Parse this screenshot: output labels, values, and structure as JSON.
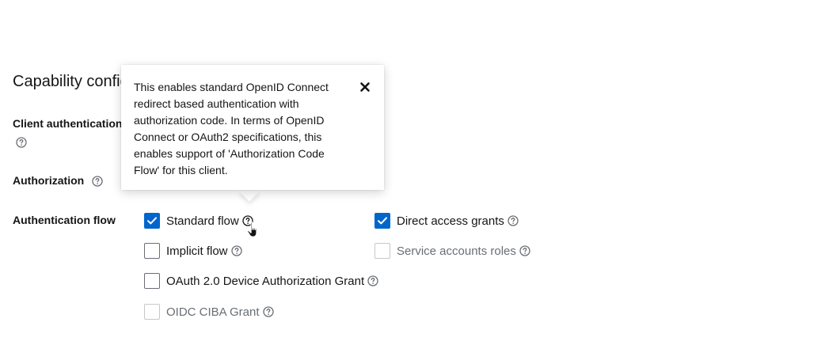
{
  "section": {
    "title": "Capability config"
  },
  "fields": {
    "client_authentication_label": "Client authentication",
    "authorization_label": "Authorization",
    "authentication_flow_label": "Authentication flow"
  },
  "flows": {
    "standard_flow": {
      "label": "Standard flow",
      "checked": true,
      "disabled": false
    },
    "implicit_flow": {
      "label": "Implicit flow",
      "checked": false,
      "disabled": false
    },
    "device_grant": {
      "label": "OAuth 2.0 Device Authorization Grant",
      "checked": false,
      "disabled": false
    },
    "oidc_ciba": {
      "label": "OIDC CIBA Grant",
      "checked": false,
      "disabled": true
    },
    "direct_access": {
      "label": "Direct access grants",
      "checked": true,
      "disabled": false
    },
    "service_accounts": {
      "label": "Service accounts roles",
      "checked": false,
      "disabled": true
    }
  },
  "popover": {
    "text": "This enables standard OpenID Connect redirect based authentication with authorization code. In terms of OpenID Connect or OAuth2 specifications, this enables support of 'Authorization Code Flow' for this client."
  },
  "icons": {
    "help": "help-circle-icon",
    "close": "close-icon",
    "check": "checkmark-icon",
    "cursor": "hand-pointer-icon"
  },
  "colors": {
    "accent": "#0066cc",
    "text": "#151515",
    "muted": "#6a6e73",
    "disabled_border": "#c7c7c7"
  }
}
